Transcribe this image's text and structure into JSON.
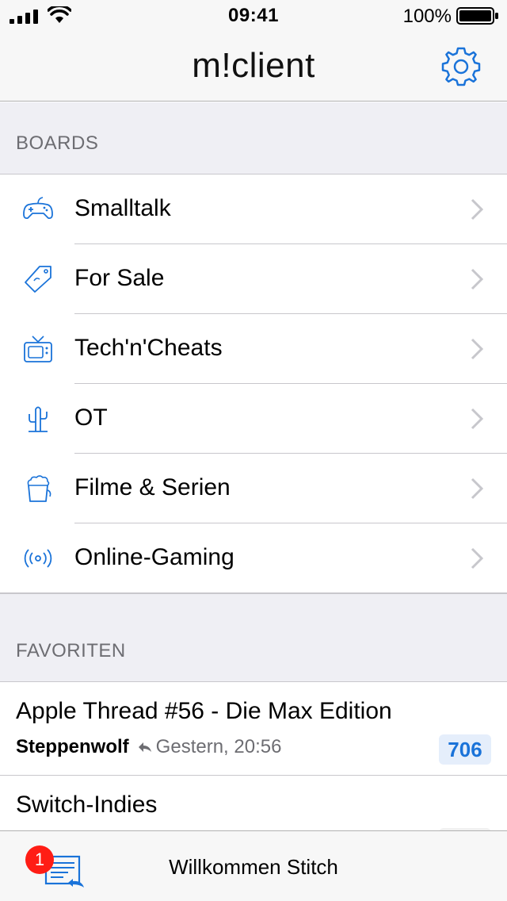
{
  "status_bar": {
    "time": "09:41",
    "battery_percent": "100%",
    "battery_level": 1.0
  },
  "nav": {
    "title": "m!client",
    "settings_icon": "gear-icon"
  },
  "boards_section": {
    "header": "BOARDS",
    "items": [
      {
        "label": "Smalltalk",
        "icon": "gamepad-icon"
      },
      {
        "label": "For Sale",
        "icon": "price-tag-icon"
      },
      {
        "label": "Tech'n'Cheats",
        "icon": "tv-icon"
      },
      {
        "label": "OT",
        "icon": "cactus-icon"
      },
      {
        "label": "Filme & Serien",
        "icon": "popcorn-icon"
      },
      {
        "label": "Online-Gaming",
        "icon": "broadcast-icon"
      }
    ]
  },
  "favorites_section": {
    "header": "FAVORITEN",
    "items": [
      {
        "title": "Apple Thread #56 - Die Max Edition",
        "author": "Steppenwolf",
        "time": "Gestern, 20:56",
        "count": "706"
      },
      {
        "title": "Switch-Indies",
        "author": "",
        "time": "",
        "count": ""
      }
    ]
  },
  "tab_bar": {
    "badge": "1",
    "welcome": "Willkommen Stitch",
    "icon": "messages-reply-icon"
  },
  "colors": {
    "accent": "#1a73d9",
    "badge": "#ff1d15",
    "group_bg": "#efeff4"
  }
}
